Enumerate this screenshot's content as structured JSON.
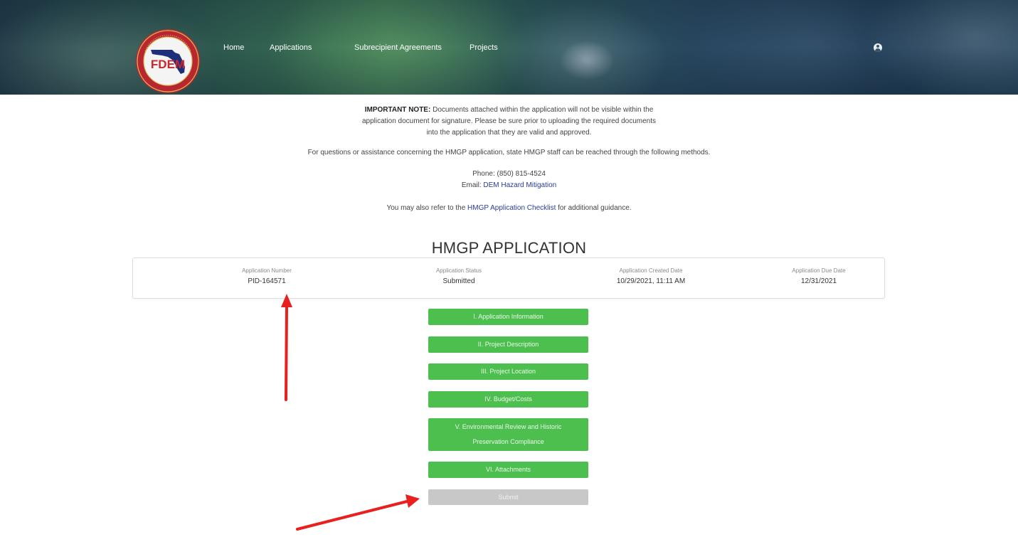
{
  "header": {
    "logo_text": "FDEM",
    "logo_ring_top": "DIVISION OF EMERGENCY MANAGEMENT",
    "logo_ring_bottom": "OFFICE OF THE GOVERNOR",
    "nav": [
      {
        "label": "Home"
      },
      {
        "label": "Applications"
      },
      {
        "label": "Subrecipient Agreements"
      },
      {
        "label": "Projects"
      }
    ],
    "user_icon": "user-avatar-icon"
  },
  "notice": {
    "important_label": "IMPORTANT NOTE:",
    "line1_rest": " Documents attached within the application will not be visible within the",
    "line2": "application document for signature. Please be sure prior to uploading the required documents",
    "line3": "into the application that they are valid and approved.",
    "questions": "For questions or assistance concerning the HMGP application, state HMGP staff can be reached through the following methods.",
    "phone": "Phone: (850) 815-4524",
    "email_label": "Email: ",
    "email_link": "DEM Hazard Mitigation",
    "refer_prefix": "You may also refer to the ",
    "refer_link": "HMGP Application Checklist",
    "refer_suffix": " for additional guidance."
  },
  "page_title": "HMGP APPLICATION",
  "info": [
    {
      "label": "Application Number",
      "value": "PID-164571"
    },
    {
      "label": "Application Status",
      "value": "Submitted"
    },
    {
      "label": "Application Created Date",
      "value": "10/29/2021, 11:11 AM"
    },
    {
      "label": "Application Due Date",
      "value": "12/31/2021"
    }
  ],
  "sections": [
    {
      "label": "I. Application Information"
    },
    {
      "label": "II. Project Description"
    },
    {
      "label": "III. Project Location"
    },
    {
      "label": "IV. Budget/Costs"
    },
    {
      "label_line1": "V. Environmental Review and Historic",
      "label_line2": "Preservation Compliance"
    },
    {
      "label": "VI. Attachments"
    }
  ],
  "submit_label": "Submit",
  "colors": {
    "section_green": "#4cbf4f",
    "submit_disabled": "#c8c8c8",
    "link_blue": "#2a3d9a",
    "arrow_red": "#e8201e"
  }
}
